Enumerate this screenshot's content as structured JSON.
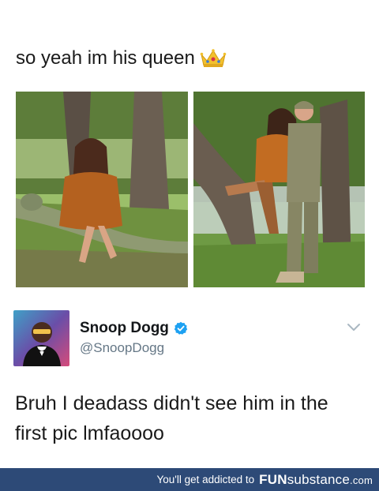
{
  "post": {
    "caption": "so yeah im his queen",
    "caption_emoji": "crown-emoji"
  },
  "photos": [
    {
      "subject": "couple-photo-hidden-soldier"
    },
    {
      "subject": "couple-photo-embrace"
    }
  ],
  "tweet": {
    "display_name": "Snoop Dogg",
    "handle": "@SnoopDogg",
    "verified": true,
    "text": "Bruh I deadass didn't see him in the first pic lmfaoooo",
    "accent_color": "#1da1f2"
  },
  "footer": {
    "tagline": "You'll get addicted to",
    "brand_bold": "FUN",
    "brand_rest": "substance",
    "brand_tld": ".com",
    "background": "#2d4a77"
  }
}
